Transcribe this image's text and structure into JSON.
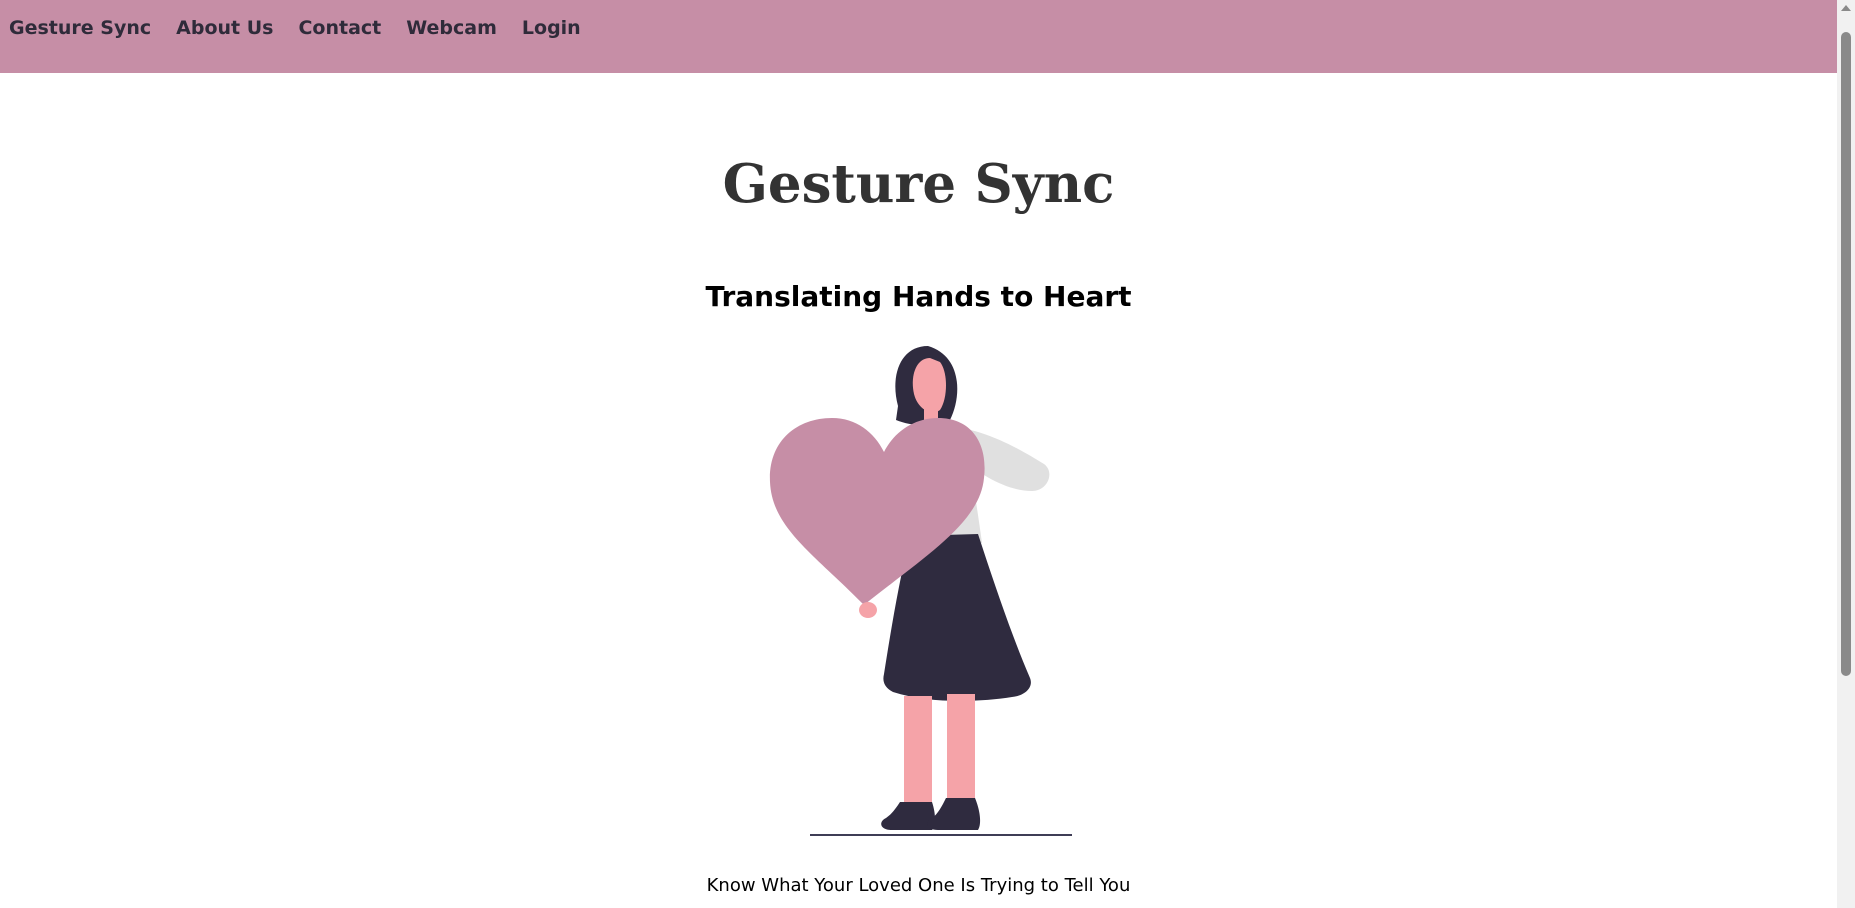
{
  "nav": {
    "items": [
      {
        "label": "Gesture Sync"
      },
      {
        "label": "About Us"
      },
      {
        "label": "Contact"
      },
      {
        "label": "Webcam"
      },
      {
        "label": "Login"
      }
    ]
  },
  "hero": {
    "title": "Gesture Sync",
    "tagline": "Translating Hands to Heart",
    "subtitle": "Know What Your Loved One Is Trying to Tell You"
  },
  "colors": {
    "nav_background": "#c68ea6",
    "heart": "#c68ea6",
    "skin": "#f5a3a8",
    "dark": "#2f2b3f",
    "sweater": "#e0e0e0"
  }
}
